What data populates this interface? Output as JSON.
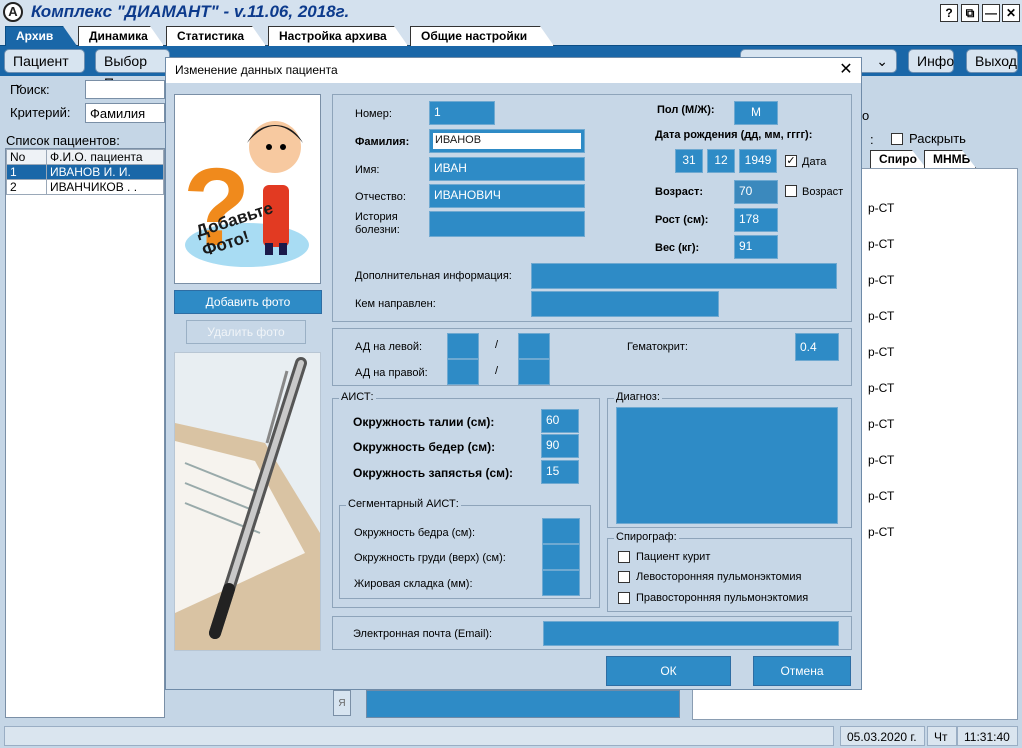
{
  "app": {
    "title": "Комплекс \"ДИАМАНТ\"  -  v.11.06, 2018г."
  },
  "window_buttons": [
    "?",
    "⧉",
    "—",
    "✕"
  ],
  "tabs": [
    "Архив",
    "Динамика",
    "Статистика",
    "Настройка архива",
    "Общие настройки"
  ],
  "toolbar": {
    "patient": "Пациент",
    "select": "Выбор Пр",
    "info": "Инфо",
    "exit": "Выход"
  },
  "left": {
    "search_label": "Поиск:",
    "criterion_label": "Критерий:",
    "criterion_value": "Фамилия",
    "list_label": "Список пациентов:",
    "columns": [
      "No",
      "Ф.И.О. пациента"
    ],
    "rows": [
      [
        "1",
        "ИВАНОВ И. И."
      ],
      [
        "2",
        "ИВАНЧИКОВ  .  ."
      ]
    ]
  },
  "right": {
    "expand_label": "Раскрыть",
    "tabs": [
      "Спиро",
      "МНМБ"
    ],
    "items": [
      "р-СТ",
      "р-СТ",
      "р-СТ",
      "р-СТ",
      "р-СТ",
      "р-СТ",
      "р-СТ",
      "р-СТ",
      "р-СТ",
      "р-СТ"
    ]
  },
  "status": {
    "date": "05.03.2020 г.",
    "day": "Чт",
    "time": "11:31:40"
  },
  "dialog": {
    "title": "Изменение данных пациента",
    "photo_text": "Добавьте Фото!",
    "add_photo": "Добавить фото",
    "delete_photo": "Удалить фото",
    "number_label": "Номер:",
    "number": "1",
    "surname_label": "Фамилия:",
    "surname": "ИВАНОВ",
    "name_label": "Имя:",
    "name": "ИВАН",
    "patronymic_label": "Отчество:",
    "patronymic": "ИВАНОВИЧ",
    "history_label": "История болезни:",
    "sex_label": "Пол (М/Ж):",
    "sex": "М",
    "birth_label": "Дата рождения (дд, мм, гггг):",
    "birth_day": "31",
    "birth_month": "12",
    "birth_year": "1949",
    "date_check_label": "Дата",
    "age_label": "Возраст:",
    "age": "70",
    "age_check_label": "Возраст",
    "height_label": "Рост (см):",
    "height": "178",
    "weight_label": "Вес (кг):",
    "weight": "91",
    "extra_label": "Дополнительная информация:",
    "referrer_label": "Кем направлен:",
    "bp_left_label": "АД на левой:",
    "bp_right_label": "АД на правой:",
    "slash": "/",
    "hematocrit_label": "Гематокрит:",
    "hematocrit": "0.4",
    "aist_title": "АИСТ:",
    "waist_label": "Окружность талии (см):",
    "waist": "60",
    "hips_label": "Окружность бедер (см):",
    "hips": "90",
    "wrist_label": "Окружность запястья (см):",
    "wrist": "15",
    "seg_title": "Сегментарный АИСТ:",
    "thigh_label": "Окружность бедра (см):",
    "chest_label": "Окружность груди (верх) (см):",
    "fold_label": "Жировая складка (мм):",
    "diagnosis_title": "Диагноз:",
    "spiro_title": "Спирограф:",
    "smoker_label": "Пациент курит",
    "left_pn_label": "Левосторонняя пульмонэктомия",
    "right_pn_label": "Правосторонняя пульмонэктомия",
    "email_label": "Электронная почта (Email):",
    "ok": "ОК",
    "cancel": "Отмена"
  },
  "colors": {
    "accent": "#1a67a8",
    "field": "#2e8bc6",
    "background": "#c5d6e6"
  }
}
